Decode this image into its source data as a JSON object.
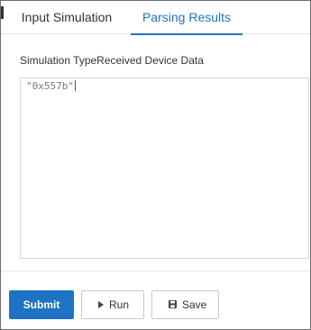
{
  "tabs": [
    {
      "label": "Input Simulation",
      "active": false
    },
    {
      "label": "Parsing Results",
      "active": true
    }
  ],
  "section": {
    "label": "Simulation TypeReceived Device Data"
  },
  "editor": {
    "content": "\"0x557b\""
  },
  "actions": {
    "submit_label": "Submit",
    "run_label": "Run",
    "save_label": "Save"
  },
  "icons": {
    "run": "play-icon",
    "save": "floppy-disk-icon"
  },
  "colors": {
    "accent": "#1f73c4",
    "border": "#d9d9d9",
    "text": "#333333"
  }
}
